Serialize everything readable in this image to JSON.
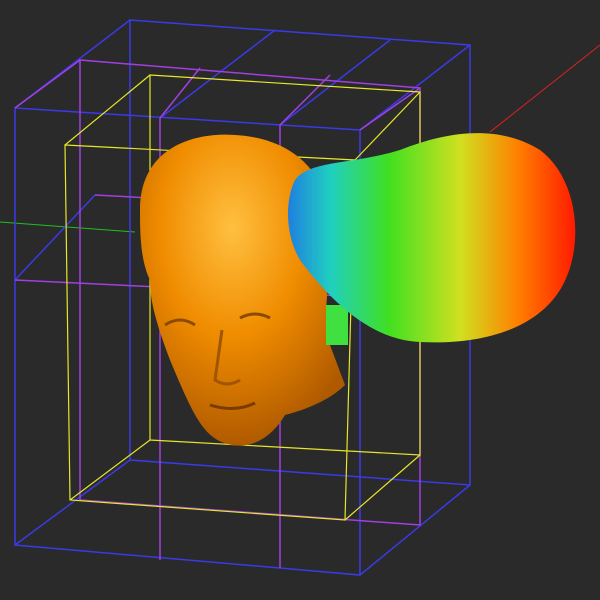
{
  "scene": {
    "background": "#2a2a2a",
    "colors": {
      "outer_box": "#3a3ae6",
      "middle_box": "#a040e0",
      "inner_box": "#e6e62a",
      "head": "#f08c00",
      "axis_x": "#e02020",
      "axis_y": "#20c020",
      "lobe_gradient": [
        "#1f7fe0",
        "#20e0a0",
        "#40e020",
        "#e0e020",
        "#ff8000",
        "#ff1a00"
      ]
    },
    "objects": [
      "head-model",
      "radiation-pattern-lobe",
      "bounding-boxes",
      "coordinate-axes"
    ]
  }
}
